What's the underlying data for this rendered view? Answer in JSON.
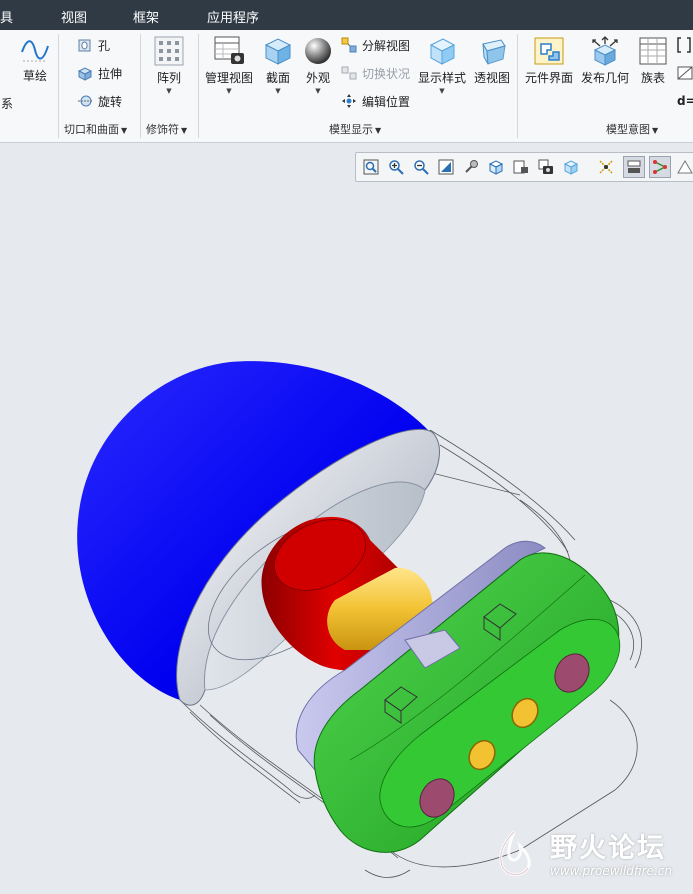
{
  "menu": {
    "items": [
      "具",
      "视图",
      "框架",
      "应用程序"
    ]
  },
  "ribbon": {
    "sketch": {
      "cut_left": "系",
      "label": "草绘"
    },
    "cuts": {
      "hole": "孔",
      "extrude": "拉伸",
      "revolve": "旋转",
      "group_title": "切口和曲面"
    },
    "pattern": {
      "label": "阵列",
      "group_title": "修饰符"
    },
    "model_display": {
      "manage_views": "管理视图",
      "section": "截面",
      "appearance": "外观",
      "exploded_view": "分解视图",
      "toggle_status": "切换状况",
      "edit_position": "编辑位置",
      "display_style": "显示样式",
      "perspective": "透视图",
      "group_title": "模型显示"
    },
    "model_intent": {
      "component_interface": "元件界面",
      "publish_geometry": "发布几何",
      "family_table": "族表",
      "d_eq": "d=",
      "group_title": "模型意图"
    }
  },
  "watermark": {
    "text": "野火论坛",
    "url": "www.proewildfire.cn"
  },
  "colors": {
    "menubar": "#2f3a44",
    "cap_blue": "#0000f0",
    "red_hub": "#c40000",
    "yellow_shaft": "#f2c233",
    "green_block": "#2fc02f",
    "purple_hole": "#9c4a6e"
  }
}
